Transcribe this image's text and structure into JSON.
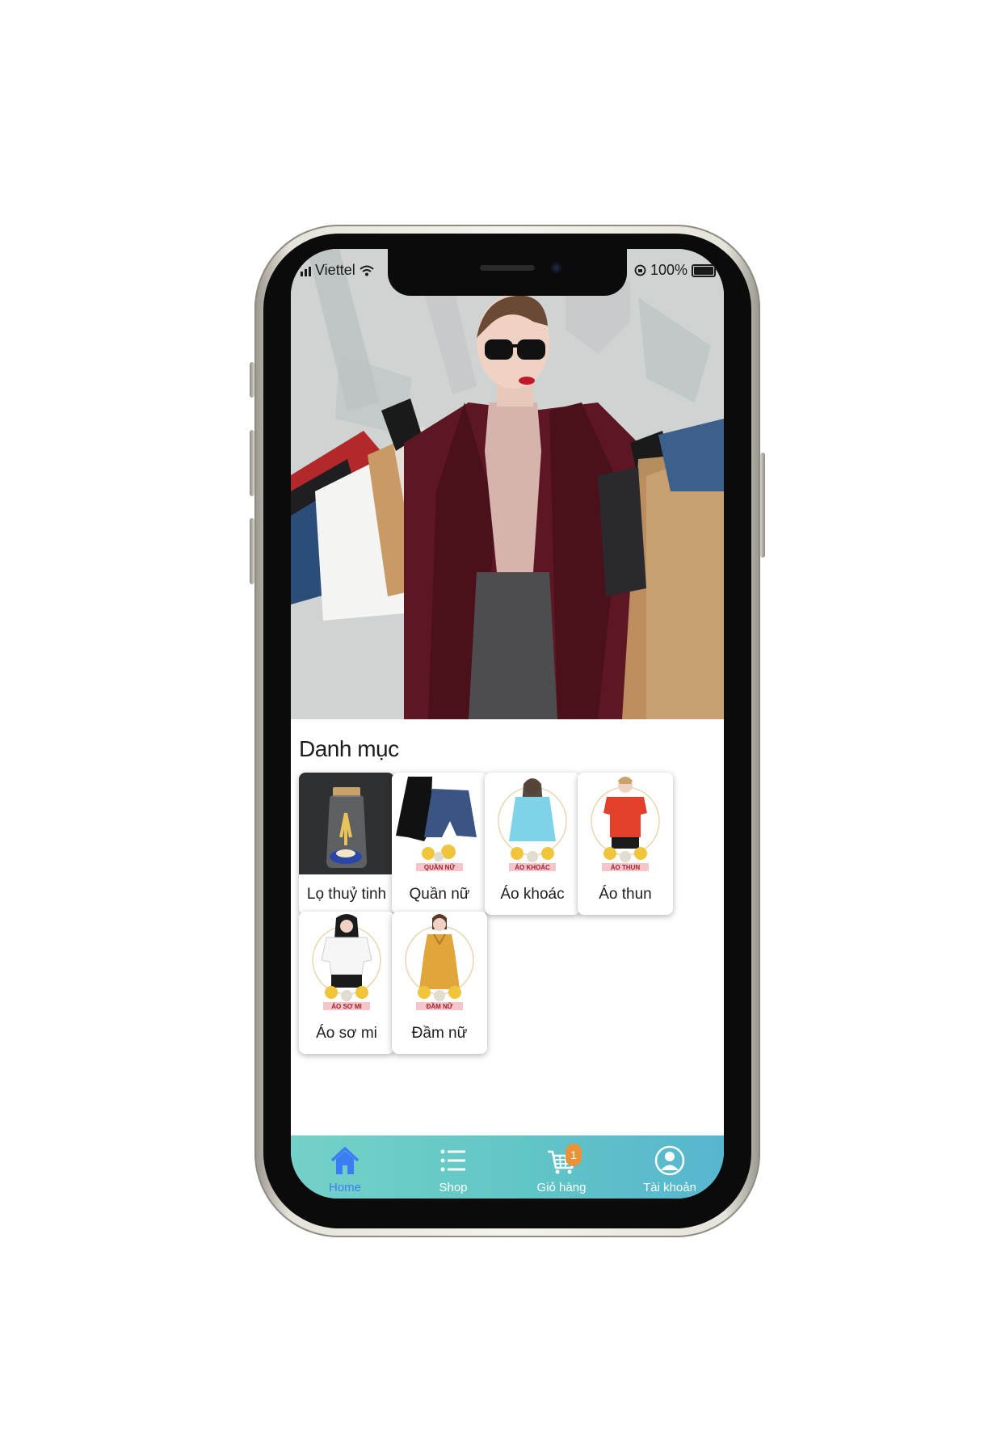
{
  "status_bar": {
    "carrier": "Viettel",
    "battery": "100%"
  },
  "section": {
    "title": "Danh mục"
  },
  "categories": [
    {
      "label": "Lọ thuỷ tinh",
      "banner": ""
    },
    {
      "label": "Quần nữ",
      "banner": "QUẦN NỮ"
    },
    {
      "label": "Áo khoác",
      "banner": "ÁO KHOÁC"
    },
    {
      "label": "Áo thun",
      "banner": "ÁO THUN"
    },
    {
      "label": "Áo sơ mi",
      "banner": "ÁO SƠ MI"
    },
    {
      "label": "Đầm nữ",
      "banner": "ĐẦM NỮ"
    }
  ],
  "tabbar": {
    "items": [
      {
        "label": "Home",
        "icon": "home-icon",
        "active": true
      },
      {
        "label": "Shop",
        "icon": "list-icon"
      },
      {
        "label": "Giỏ hàng",
        "icon": "cart-icon",
        "badge": "1"
      },
      {
        "label": "Tài khoản",
        "icon": "user-icon"
      }
    ]
  },
  "colors": {
    "tabbar_start": "#74d1c9",
    "tabbar_end": "#56b6cf",
    "active_tab": "#3c7cf4",
    "badge": "#e8933a"
  }
}
